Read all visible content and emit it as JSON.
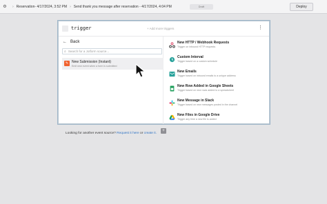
{
  "topbar": {
    "crumb1": "Reservation- 4/17/2024, 3:52 PM",
    "crumb2": "Send thank you message after reservation  - 4/17/2024, 4:04 PM",
    "draft_label": "Draft",
    "deploy_label": "Deploy"
  },
  "card": {
    "title": "trigger",
    "add_more": "+ Add more triggers",
    "back_label": "Back",
    "search_placeholder": "Search for a Jotform source...",
    "source": {
      "title": "New Submission (Instant)",
      "desc": "Emit new event when a form is submitted"
    },
    "footer": {
      "prefix": "Looking for another event source?",
      "link": "Request it here",
      "mid": "or",
      "link2": "create it."
    }
  },
  "triggers": [
    {
      "name": "New HTTP / Webhook Requests",
      "desc": "Trigger on inbound HTTP requests",
      "icon": "webhook-icon",
      "color": "#d93a5b"
    },
    {
      "name": "Custom Interval",
      "desc": "Trigger based on a custom schedule",
      "icon": "clock-icon",
      "color": "#29a29b"
    },
    {
      "name": "New Emails",
      "desc": "Trigger based on inbound emails to a unique address",
      "icon": "email-icon",
      "color": "#29a29b"
    },
    {
      "name": "New Row Added in Google Sheets",
      "desc": "Trigger based on new rows added to a spreadsheet",
      "icon": "google-sheets-icon",
      "color": "#1e9e5a"
    },
    {
      "name": "New Message in Slack",
      "desc": "Trigger based on new messages posted in the channel",
      "icon": "slack-icon",
      "color": "#e01e5a"
    },
    {
      "name": "New Files in Google Drive",
      "desc": "Trigger any time a new file is added",
      "icon": "google-drive-icon",
      "color": "#f4b400"
    }
  ]
}
